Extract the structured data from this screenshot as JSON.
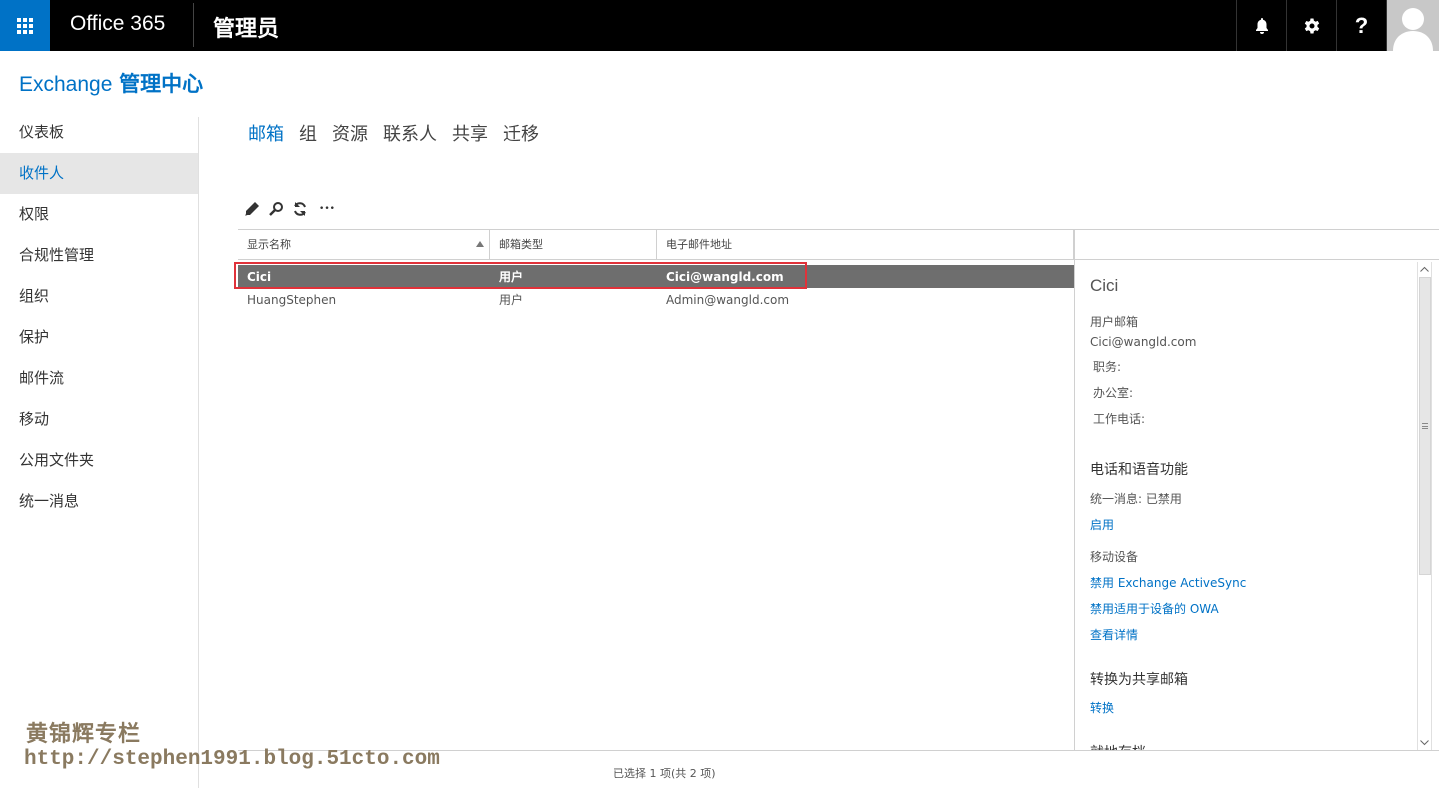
{
  "topbar": {
    "brand": "Office 365",
    "app_title": "管理员",
    "icons": [
      "waffle-icon",
      "bell-icon",
      "gear-icon",
      "help-icon",
      "avatar"
    ],
    "help_glyph": "?",
    "accent": "#0072c6",
    "background": "#000000"
  },
  "header": {
    "title_en": "Exchange",
    "title_zh": "管理中心"
  },
  "leftnav": {
    "items": [
      {
        "label": "仪表板"
      },
      {
        "label": "收件人",
        "active": true
      },
      {
        "label": "权限"
      },
      {
        "label": "合规性管理"
      },
      {
        "label": "组织"
      },
      {
        "label": "保护"
      },
      {
        "label": "邮件流"
      },
      {
        "label": "移动"
      },
      {
        "label": "公用文件夹"
      },
      {
        "label": "统一消息"
      }
    ]
  },
  "tabs": [
    {
      "label": "邮箱",
      "active": true
    },
    {
      "label": "组"
    },
    {
      "label": "资源"
    },
    {
      "label": "联系人"
    },
    {
      "label": "共享"
    },
    {
      "label": "迁移"
    }
  ],
  "toolbar": {
    "icons": [
      "edit-icon",
      "search-icon",
      "refresh-icon",
      "more-icon"
    ],
    "more_glyph": "•••"
  },
  "grid": {
    "columns": [
      "显示名称",
      "邮箱类型",
      "电子邮件地址"
    ],
    "sorted_column": "显示名称",
    "rows": [
      {
        "name": "Cici",
        "type": "用户",
        "email": "Cici@wangld.com",
        "selected": true
      },
      {
        "name": "HuangStephen",
        "type": "用户",
        "email": "Admin@wangld.com",
        "selected": false
      }
    ],
    "selection_color": "#6e6e6e",
    "highlight_color": "#e0323a"
  },
  "details": {
    "name": "Cici",
    "mailbox_type": "用户邮箱",
    "email": "Cici@wangld.com",
    "job_title_label": "职务:",
    "office_label": "办公室:",
    "work_phone_label": "工作电话:",
    "phone_section": "电话和语音功能",
    "um_status": "统一消息:  已禁用",
    "enable_link": "启用",
    "mobile_label": "移动设备",
    "disable_activesync": "禁用 Exchange ActiveSync",
    "disable_owa": "禁用适用于设备的 OWA",
    "view_details": "查看详情",
    "convert_section": "转换为共享邮箱",
    "convert_link": "转换",
    "archive_section": "就地存档"
  },
  "status": "已选择 1 项(共 2 项)",
  "watermark": {
    "line1": "黄锦辉专栏",
    "line2": "http://stephen1991.blog.51cto.com"
  }
}
